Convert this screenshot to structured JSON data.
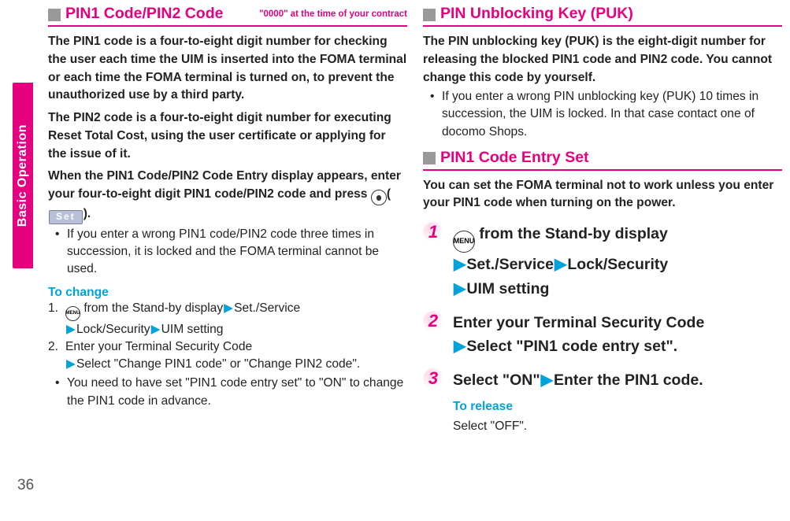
{
  "sidebar": {
    "label": "Basic Operation"
  },
  "page_number": "36",
  "left": {
    "heading": "PIN1 Code/PIN2 Code",
    "heading_note": "\"0000\" at the time of your contract",
    "p1": "The PIN1 code is a four-to-eight digit number for checking the user each time the UIM is inserted into the FOMA terminal or each time the FOMA terminal is turned on, to prevent the unauthorized use by a third party.",
    "p2": "The PIN2 code is a four-to-eight digit number for executing Reset Total Cost, using the user certificate or applying for the issue of it.",
    "p3a": "When the PIN1 Code/PIN2 Code Entry display appears, enter your four-to-eight digit PIN1 code/PIN2 code and press ",
    "set_label": "Set",
    "p3b": ").",
    "bul1": "If you enter a wrong PIN1 code/PIN2 code three times in succession, it is locked and the FOMA terminal cannot be used.",
    "change_head": "To change",
    "c1_num": "1.",
    "c1_a": " from the Stand-by display",
    "c1_b": "Set./Service",
    "c1_c": "Lock/Security",
    "c1_d": "UIM setting",
    "menu_label": "MENU",
    "c2_num": "2.",
    "c2_a": "Enter your Terminal Security Code",
    "c2_b": "Select \"Change PIN1 code\" or \"Change PIN2 code\".",
    "bul2": "You need to have set \"PIN1 code entry set\" to \"ON\" to change the PIN1 code in advance."
  },
  "right": {
    "heading1": "PIN Unblocking Key (PUK)",
    "p1": "The PIN unblocking key (PUK) is the eight-digit number for releasing the blocked PIN1 code and PIN2 code. You cannot change this code by yourself.",
    "bul1": "If you enter a wrong PIN unblocking key (PUK) 10 times in succession, the UIM is locked. In that case contact one of docomo Shops.",
    "heading2": "PIN1 Code Entry Set",
    "p2": "You can set the FOMA terminal not to work unless you enter your PIN1 code when turning on the power.",
    "menu_label": "MENU",
    "s1a": " from the Stand-by display",
    "s1b": "Set./Service",
    "s1c": "Lock/Security",
    "s1d": "UIM setting",
    "s2a": "Enter your Terminal Security Code",
    "s2b": "Select \"PIN1 code entry set\".",
    "s3a": "Select \"ON\"",
    "s3b": "Enter the PIN1 code.",
    "release_head": "To release",
    "release_body": "Select \"OFF\"."
  }
}
